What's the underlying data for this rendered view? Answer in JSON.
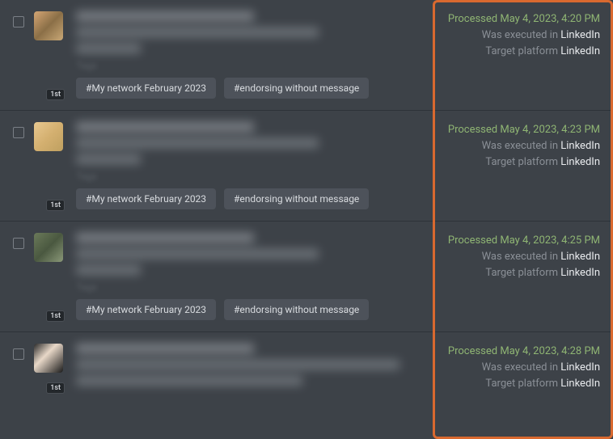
{
  "labels": {
    "processed_prefix": "Processed",
    "executed_in": "Was executed in",
    "target_platform": "Target platform",
    "tags_label": "Tags"
  },
  "rows": [
    {
      "degree": "1st",
      "processed": "May 4, 2023, 4:20 PM",
      "executed_in": "LinkedIn",
      "target_platform": "LinkedIn",
      "tags": [
        "#My network February 2023",
        "#endorsing without message"
      ]
    },
    {
      "degree": "1st",
      "processed": "May 4, 2023, 4:23 PM",
      "executed_in": "LinkedIn",
      "target_platform": "LinkedIn",
      "tags": [
        "#My network February 2023",
        "#endorsing without message"
      ]
    },
    {
      "degree": "1st",
      "processed": "May 4, 2023, 4:25 PM",
      "executed_in": "LinkedIn",
      "target_platform": "LinkedIn",
      "tags": [
        "#My network February 2023",
        "#endorsing without message"
      ]
    },
    {
      "degree": "1st",
      "processed": "May 4, 2023, 4:28 PM",
      "executed_in": "LinkedIn",
      "target_platform": "LinkedIn",
      "tags": []
    }
  ]
}
